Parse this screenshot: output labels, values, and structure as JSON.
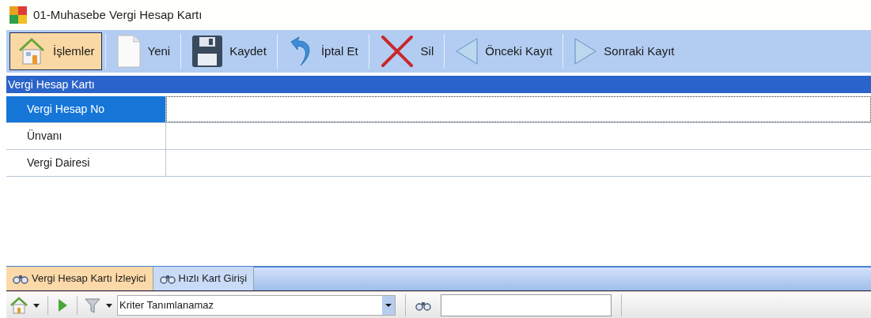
{
  "window": {
    "title": "01-Muhasebe Vergi Hesap Kartı"
  },
  "toolbar": [
    {
      "kind": "home",
      "label": "İşlemler",
      "selected": true
    },
    {
      "kind": "new",
      "label": "Yeni",
      "selected": false
    },
    {
      "kind": "save",
      "label": "Kaydet",
      "selected": false
    },
    {
      "kind": "undo",
      "label": "İptal Et",
      "selected": false
    },
    {
      "kind": "delete",
      "label": "Sil",
      "selected": false
    },
    {
      "kind": "prev",
      "label": "Önceki Kayıt",
      "selected": false
    },
    {
      "kind": "next",
      "label": "Sonraki Kayıt",
      "selected": false
    }
  ],
  "panel": {
    "title": "Vergi Hesap Kartı",
    "rows": [
      {
        "label": "Vergi Hesap No",
        "selected": true
      },
      {
        "label": "Ünvanı",
        "selected": false
      },
      {
        "label": "Vergi Dairesi",
        "selected": false
      }
    ]
  },
  "tabs": [
    {
      "label": "Vergi Hesap Kartı İzleyici",
      "selected": true
    },
    {
      "label": "Hızlı Kart Girişi",
      "selected": false
    }
  ],
  "filter": {
    "value": "Kriter Tanımlanamaz"
  }
}
